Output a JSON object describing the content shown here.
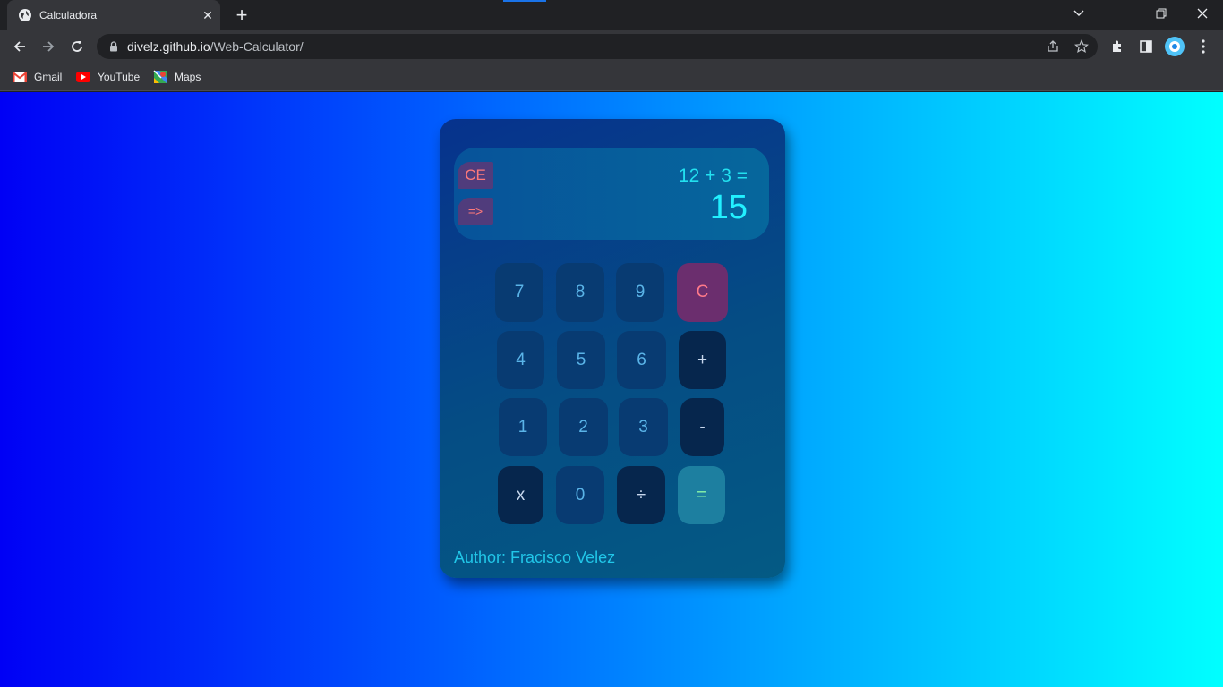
{
  "browser": {
    "tab_title": "Calculadora",
    "tab_close": "✕",
    "new_tab": "+",
    "url_host": "divelz.github.io",
    "url_path": "/Web-Calculator/",
    "bookmarks": [
      {
        "label": "Gmail",
        "icon": "gmail-icon"
      },
      {
        "label": "YouTube",
        "icon": "youtube-icon"
      },
      {
        "label": "Maps",
        "icon": "maps-icon"
      }
    ]
  },
  "calculator": {
    "display": {
      "ce_label": "CE",
      "back_label": "=>",
      "expression": "12 + 3 =",
      "result": "15"
    },
    "keys": {
      "k7": "7",
      "k8": "8",
      "k9": "9",
      "clear": "C",
      "k4": "4",
      "k5": "5",
      "k6": "6",
      "plus": "+",
      "k1": "1",
      "k2": "2",
      "k3": "3",
      "minus": "-",
      "mul": "x",
      "k0": "0",
      "div": "÷",
      "equals": "="
    },
    "author": "Author: Fracisco Velez"
  },
  "colors": {
    "page_gradient_start": "#0000f5",
    "page_gradient_end": "#00ffff",
    "display_text": "#22e0f0",
    "clear_text": "#ff7a7a",
    "equals_text": "#8cf7a8"
  }
}
